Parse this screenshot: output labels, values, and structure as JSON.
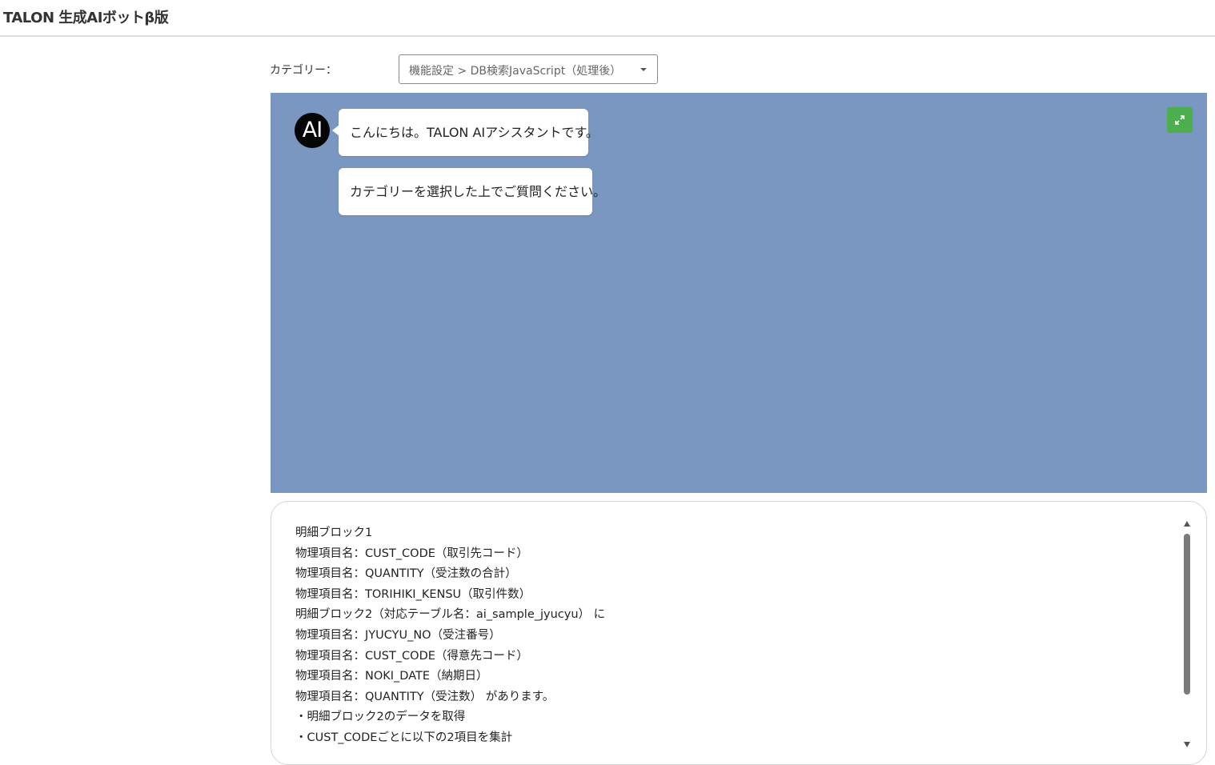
{
  "header": {
    "title": "TALON 生成AIボットβ版"
  },
  "category": {
    "label": "カテゴリー：",
    "selected": "機能設定 > DB検索JavaScript（処理後）"
  },
  "chat": {
    "background_color": "#7a97c1",
    "avatar_text": "AI",
    "messages": [
      "こんにちは。TALON AIアシスタントです。",
      "カテゴリーを選択した上でご質問ください。"
    ],
    "expand_icon": "expand-arrows-icon",
    "expand_button_color": "#4cae4c"
  },
  "input": {
    "lines": [
      "明細ブロック1",
      "物理項目名：CUST_CODE（取引先コード）",
      "物理項目名：QUANTITY（受注数の合計）",
      "物理項目名：TORIHIKI_KENSU（取引件数）",
      "明細ブロック2（対応テーブル名：ai_sample_jyucyu） に",
      "物理項目名：JYUCYU_NO（受注番号）",
      "物理項目名：CUST_CODE（得意先コード）",
      "物理項目名：NOKI_DATE（納期日）",
      "物理項目名：QUANTITY（受注数） があります。",
      "・明細ブロック2のデータを取得",
      "・CUST_CODEごとに以下の2項目を集計"
    ]
  }
}
